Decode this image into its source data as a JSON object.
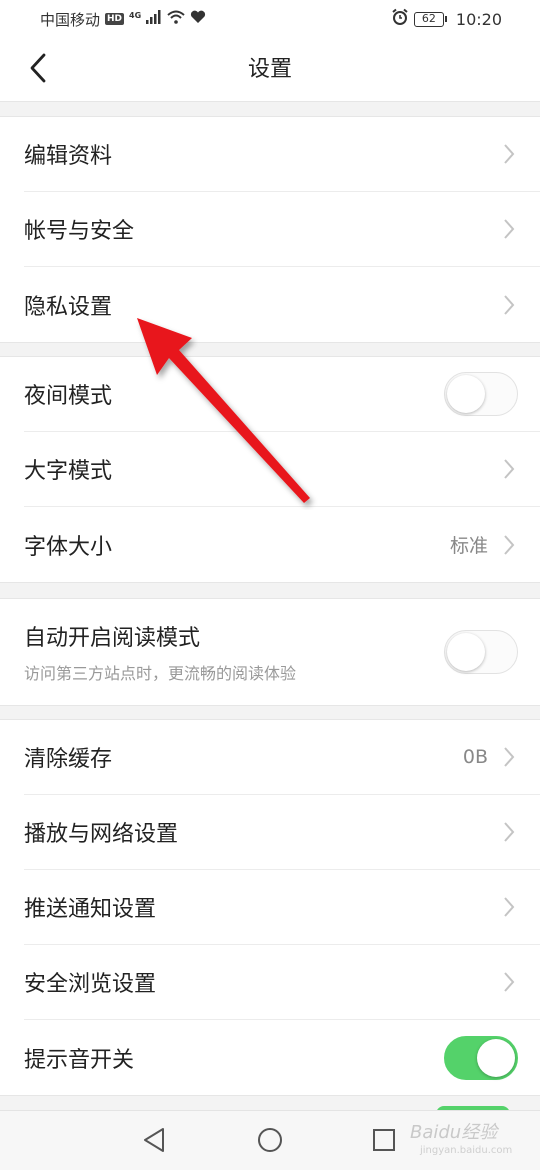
{
  "status_bar": {
    "carrier": "中国移动",
    "hd": "HD",
    "network": "4G",
    "battery": "62",
    "time": "10:20"
  },
  "header": {
    "title": "设置"
  },
  "group1": [
    {
      "label": "编辑资料"
    },
    {
      "label": "帐号与安全"
    },
    {
      "label": "隐私设置"
    }
  ],
  "group2": {
    "night_mode": {
      "label": "夜间模式",
      "on": false
    },
    "large_text": {
      "label": "大字模式"
    },
    "font_size": {
      "label": "字体大小",
      "value": "标准"
    }
  },
  "group3": {
    "auto_reading": {
      "label": "自动开启阅读模式",
      "sub": "访问第三方站点时，更流畅的阅读体验",
      "on": false
    }
  },
  "group4": {
    "clear_cache": {
      "label": "清除缓存",
      "value": "0B"
    },
    "playback": {
      "label": "播放与网络设置"
    },
    "push": {
      "label": "推送通知设置"
    },
    "safe_browse": {
      "label": "安全浏览设置"
    },
    "sound": {
      "label": "提示音开关",
      "on": true
    }
  },
  "watermark": {
    "brand": "Baidu经验",
    "url": "jingyan.baidu.com"
  },
  "colors": {
    "accent_green": "#54d26a",
    "annotation_red": "#e8141b"
  },
  "icons": [
    "signal-icon",
    "wifi-icon",
    "heart-icon",
    "alarm-icon",
    "battery-icon",
    "back-arrow-icon",
    "chevron-right-icon",
    "nav-back-icon",
    "nav-home-icon",
    "nav-recents-icon",
    "red-arrow-annotation-icon"
  ]
}
